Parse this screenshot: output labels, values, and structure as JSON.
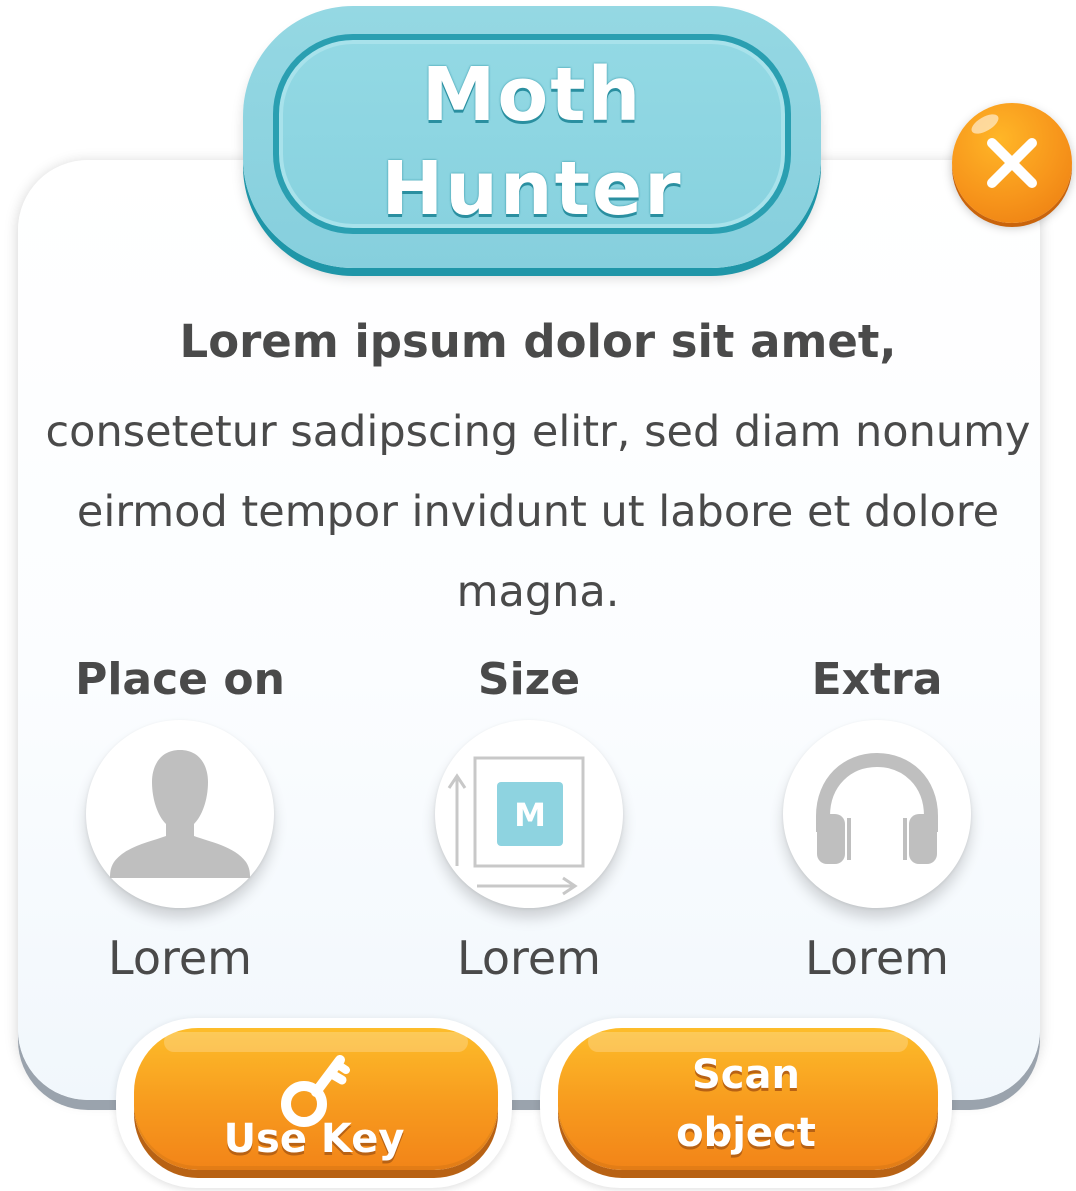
{
  "title": "Moth\nHunter",
  "lead_text": "Lorem ipsum dolor sit amet,",
  "body_text": "consetetur sadipscing elitr, sed diam nonumy eirmod tempor invidunt ut labore et dolore magna.",
  "features": [
    {
      "heading": "Place on",
      "icon": "person-icon",
      "value": "Lorem"
    },
    {
      "heading": "Size",
      "icon": "size-icon",
      "badge": "M",
      "value": "Lorem"
    },
    {
      "heading": "Extra",
      "icon": "headphones-icon",
      "value": "Lorem"
    }
  ],
  "buttons": {
    "use_key": {
      "label": "Use Key",
      "icon": "key-icon"
    },
    "scan_object": {
      "label": "Scan\nobject"
    }
  },
  "colors": {
    "plaque": "#8ed3e0",
    "plaque_border": "#2a9fb1",
    "accent_orange": "#f79a1e",
    "text": "#4a4a4a",
    "icon_gray": "#bfbfbf",
    "badge": "#8ed3e0"
  }
}
